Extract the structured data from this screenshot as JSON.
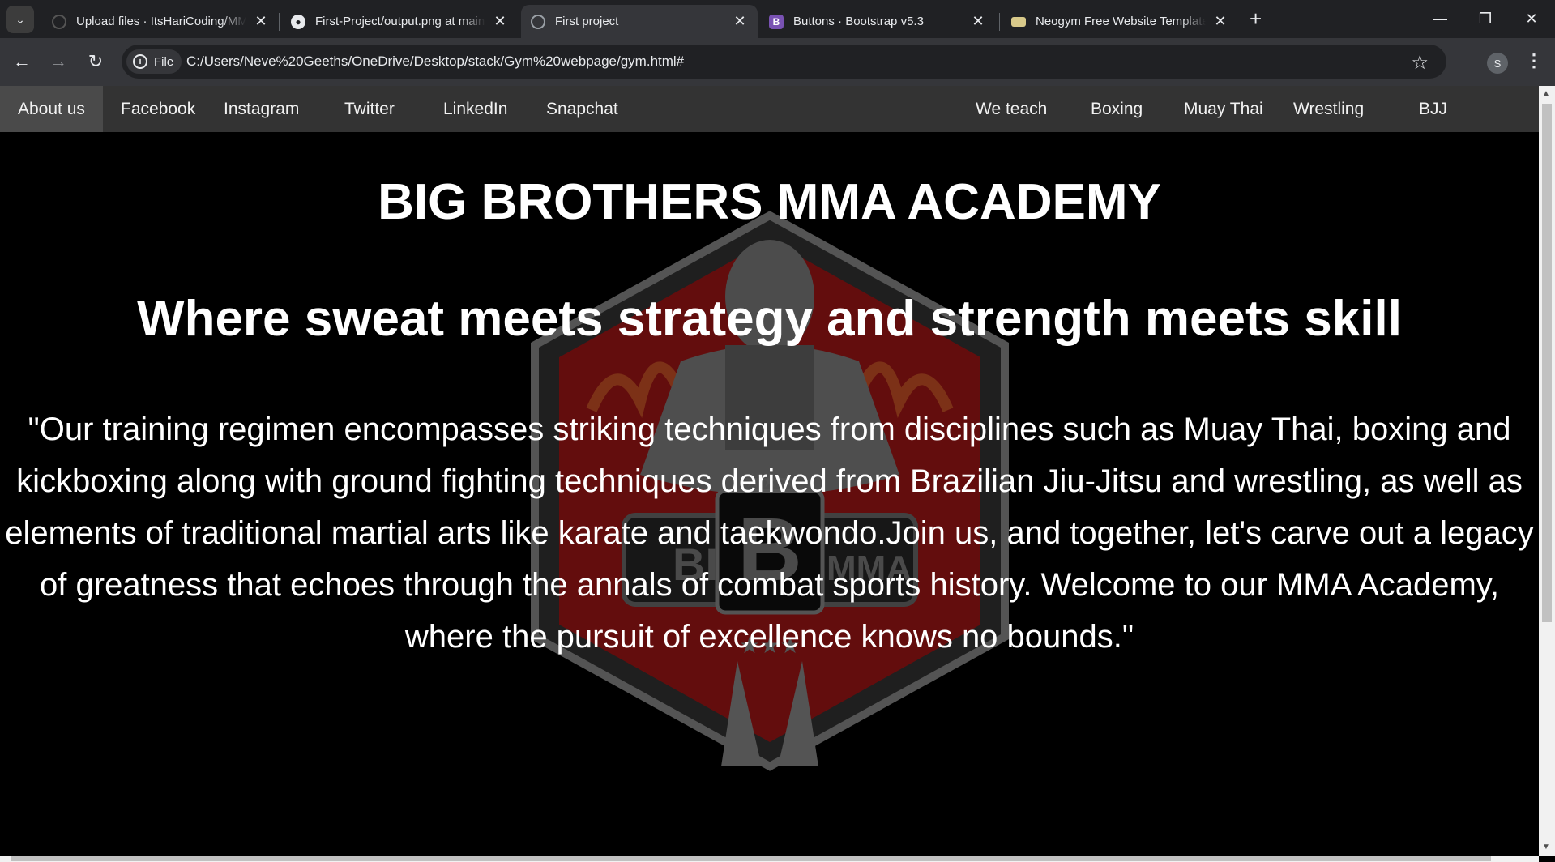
{
  "browser": {
    "tabs": [
      {
        "title": "Upload files · ItsHariCoding/MMA",
        "active": false
      },
      {
        "title": "First-Project/output.png at main · ItsHariCoding",
        "active": false
      },
      {
        "title": "First project",
        "active": true
      },
      {
        "title": "Buttons · Bootstrap v5.3",
        "active": false
      },
      {
        "title": "Neogym Free Website Template",
        "active": false
      }
    ],
    "address_chip": "File",
    "url": "C:/Users/Neve%20Geeths/OneDrive/Desktop/stack/Gym%20webpage/gym.html#",
    "profile_initial": "S",
    "icons": [
      "tab-search-icon",
      "back-icon",
      "forward-icon",
      "reload-icon",
      "info-icon",
      "bookmark-star-icon",
      "kebab-menu-icon",
      "minimize-icon",
      "restore-icon",
      "close-icon"
    ]
  },
  "site": {
    "nav_left": [
      "About us",
      "Facebook",
      "Instagram",
      "Twitter",
      "LinkedIn",
      "Snapchat"
    ],
    "nav_right": [
      "We teach",
      "Boxing",
      "Muay Thai",
      "Wrestling",
      "BJJ"
    ],
    "active_nav": "About us",
    "title": "BIG BROTHERS MMA ACADEMY",
    "subtitle": "Where sweat meets strategy and strength meets skill",
    "paragraph": "\"Our training regimen encompasses striking techniques from disciplines such as Muay Thai, boxing and kickboxing along with ground fighting techniques derived from Brazilian Jiu-Jitsu and wrestling, as well as elements of traditional martial arts like karate and taekwondo.Join us, and together, let's carve out a legacy of greatness that echoes through the annals of combat sports history. Welcome to our MMA Academy, where the pursuit of excellence knows no bounds.\"",
    "colors": {
      "nav_bg": "#333333",
      "page_bg": "#000000",
      "text": "#ffffff",
      "logo_red": "#c41e1e"
    }
  }
}
